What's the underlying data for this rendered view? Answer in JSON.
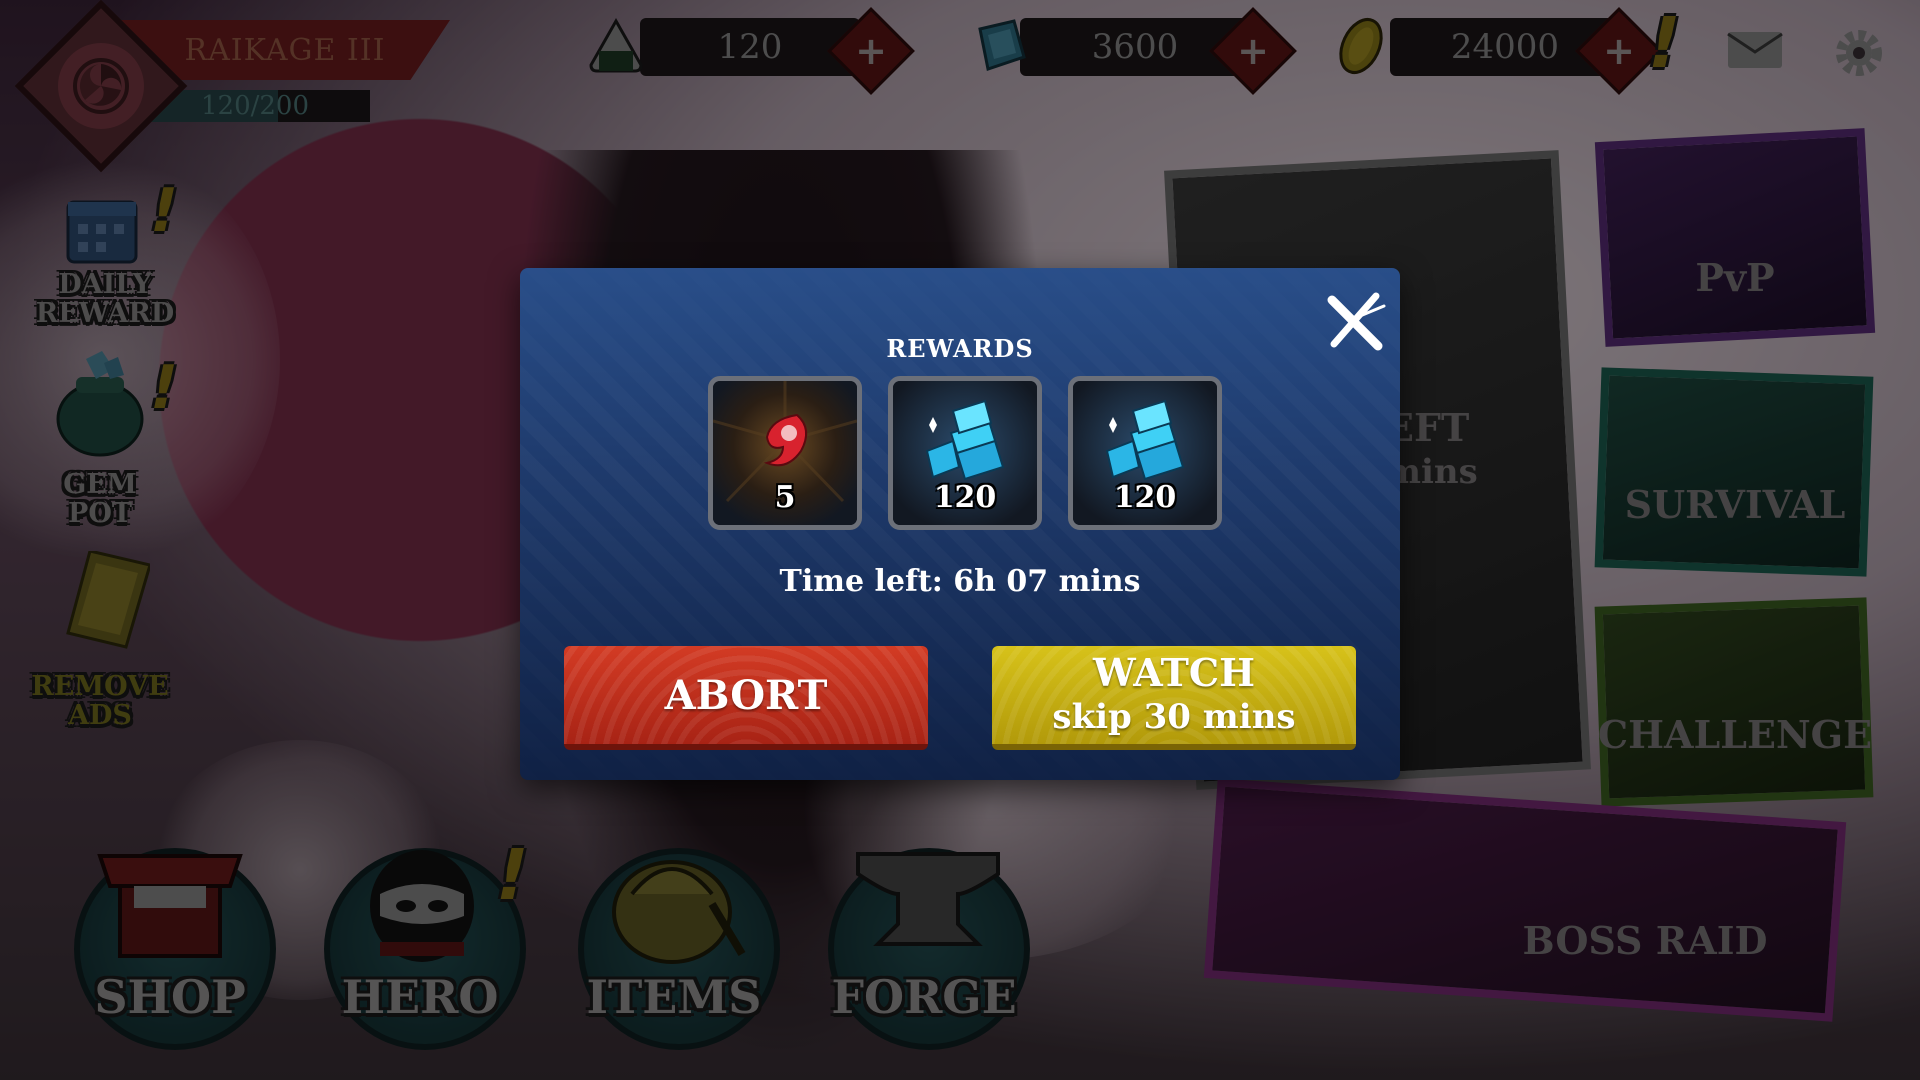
{
  "header": {
    "rank_title": "RAIKAGE III",
    "xp_text": "120/200",
    "xp_progress": 0.6,
    "currencies": [
      {
        "icon": "onigiri-icon",
        "value": "120"
      },
      {
        "icon": "gem-icon",
        "value": "3600"
      },
      {
        "icon": "gold-coin-icon",
        "value": "24000"
      }
    ],
    "plus_glyph": "+",
    "alert_glyph": "!"
  },
  "side_menu": [
    {
      "label_line1": "DAILY",
      "label_line2": "REWARD",
      "icon": "calendar-icon"
    },
    {
      "label_line1": "GEM",
      "label_line2": "POT",
      "icon": "gem-pot-icon"
    },
    {
      "label_line1": "REMOVE",
      "label_line2": "ADS",
      "icon": "remove-ads-icon"
    }
  ],
  "bottom_nav": [
    {
      "label": "SHOP",
      "icon": "shop-icon"
    },
    {
      "label": "HERO",
      "icon": "ninja-head-icon"
    },
    {
      "label": "ITEMS",
      "icon": "bag-icon"
    },
    {
      "label": "FORGE",
      "icon": "anvil-icon"
    }
  ],
  "modes": {
    "pvp": "PvP",
    "survival": "SURVIVAL",
    "challenge": "CHALLENGE",
    "boss_raid": "BOSS RAID",
    "behind_left": "EFT",
    "behind_mins": "mins"
  },
  "modal": {
    "title": "REWARDS",
    "rewards": [
      {
        "icon": "soul-flame-icon",
        "count": "5"
      },
      {
        "icon": "gem-pile-icon",
        "count": "120"
      },
      {
        "icon": "gem-pile-icon",
        "count": "120"
      }
    ],
    "time_left": "Time left: 6h 07 mins",
    "abort_label": "ABORT",
    "watch_label": "WATCH",
    "watch_sub": "skip 30 mins"
  },
  "colors": {
    "modal_bg": "#1e3a6b",
    "abort_red": "#c5321e",
    "watch_yellow": "#cdb714"
  }
}
